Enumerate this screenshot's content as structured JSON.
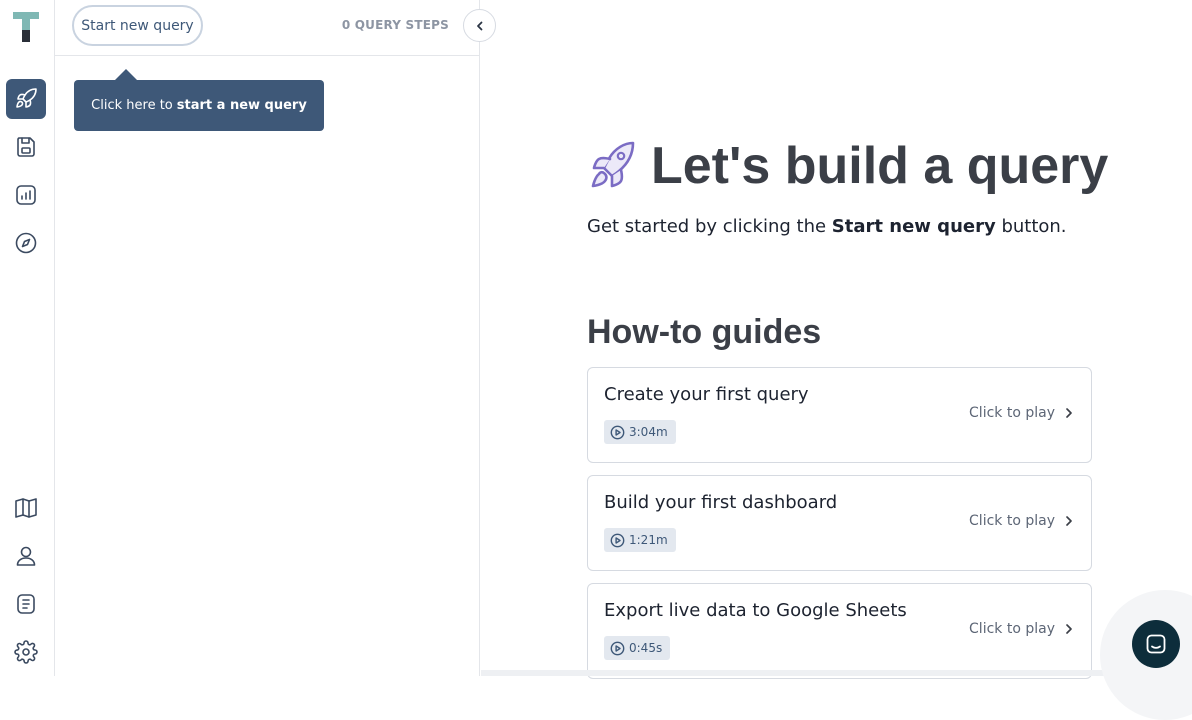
{
  "rail": {
    "logo_letter": "T",
    "items": [
      {
        "name": "rocket-icon",
        "active": true
      },
      {
        "name": "save-icon",
        "active": false
      },
      {
        "name": "report-icon",
        "active": false
      },
      {
        "name": "compass-icon",
        "active": false
      },
      {
        "name": "book-icon",
        "active": false
      },
      {
        "name": "user-icon",
        "active": false
      },
      {
        "name": "document-icon",
        "active": false
      },
      {
        "name": "gear-icon",
        "active": false
      }
    ]
  },
  "panel": {
    "start_button_label": "Start new query",
    "steps_count_label": "0 QUERY STEPS",
    "collapse_icon": "chevron-left-icon",
    "tooltip_prefix": "Click here to",
    "tooltip_bold": "start a new query"
  },
  "hero": {
    "title": "Let's build a query",
    "subtitle_prefix": "Get started by clicking the",
    "subtitle_bold": "Start new query",
    "subtitle_suffix": "button."
  },
  "guides": {
    "title": "How-to guides",
    "items": [
      {
        "title": "Create your first query",
        "duration": "3:04m",
        "action": "Click to play"
      },
      {
        "title": "Build your first dashboard",
        "duration": "1:21m",
        "action": "Click to play"
      },
      {
        "title": "Export live data to Google Sheets",
        "duration": "0:45s",
        "action": "Click to play"
      }
    ]
  },
  "colors": {
    "accent": "#3e5878",
    "chat_button": "#0d2d3b",
    "rocket_purple": "#7b6cc4"
  },
  "chat": {
    "icon": "chat-icon"
  }
}
